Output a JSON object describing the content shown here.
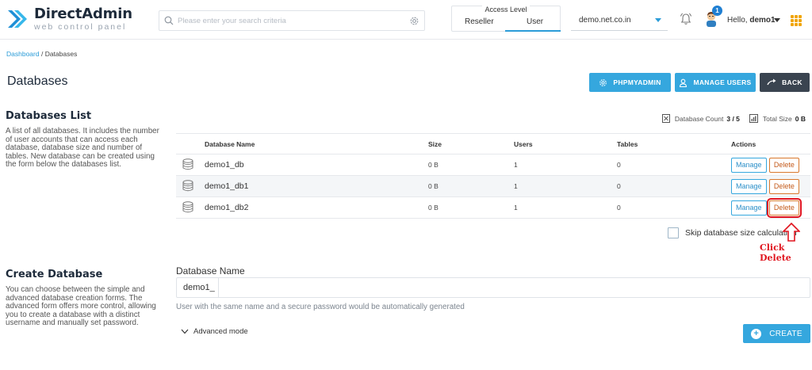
{
  "app": {
    "logo_title": "DirectAdmin",
    "logo_subtitle": "web control panel"
  },
  "header": {
    "search_placeholder": "Please enter your search criteria",
    "access_level_title": "Access Level",
    "access_options": [
      "Reseller",
      "User"
    ],
    "access_selected": "User",
    "domain": "demo.net.co.in",
    "notification_count": "1",
    "greeting": "Hello,",
    "username": "demo1"
  },
  "breadcrumb": {
    "link": "Dashboard",
    "separator": " / ",
    "current": "Databases"
  },
  "page_title": "Databases",
  "toolbar": {
    "phpmyadmin_label": "PHPMYADMIN",
    "manage_users_label": "MANAGE USERS",
    "back_label": "BACK"
  },
  "databases_list": {
    "title": "Databases List",
    "description": "A list of all databases. It includes the number of user accounts that can access each database, database size and number of tables. New database can be created using the form below the databases list.",
    "count_label": "Database Count",
    "count_value": "3 / 5",
    "size_label": "Total Size",
    "size_value": "0 B",
    "columns": [
      "Database Name",
      "Size",
      "Users",
      "Tables",
      "Actions"
    ],
    "rows": [
      {
        "name": "demo1_db",
        "size": "0 B",
        "users": "1",
        "tables": "0"
      },
      {
        "name": "demo1_db1",
        "size": "0 B",
        "users": "1",
        "tables": "0"
      },
      {
        "name": "demo1_db2",
        "size": "0 B",
        "users": "1",
        "tables": "0"
      }
    ],
    "manage_label": "Manage",
    "delete_label": "Delete",
    "skip_label": "Skip database size calculation"
  },
  "annotation": {
    "text": "Click Delete",
    "color": "#e0141e"
  },
  "create_database": {
    "title": "Create Database",
    "description": "You can choose between the simple and advanced database creation forms. The advanced form offers more control, allowing you to create a database with a distinct username and manually set password.",
    "field_label": "Database Name",
    "prefix": "demo1_",
    "value": "",
    "hint": "User with the same name and a secure password would be automatically generated",
    "advanced_label": "Advanced mode",
    "create_label": "CREATE"
  },
  "colors": {
    "accent": "#35a7de",
    "dark_button": "#3a4450",
    "delete_border": "#d9782d",
    "grid_icon": "#f0a400"
  }
}
